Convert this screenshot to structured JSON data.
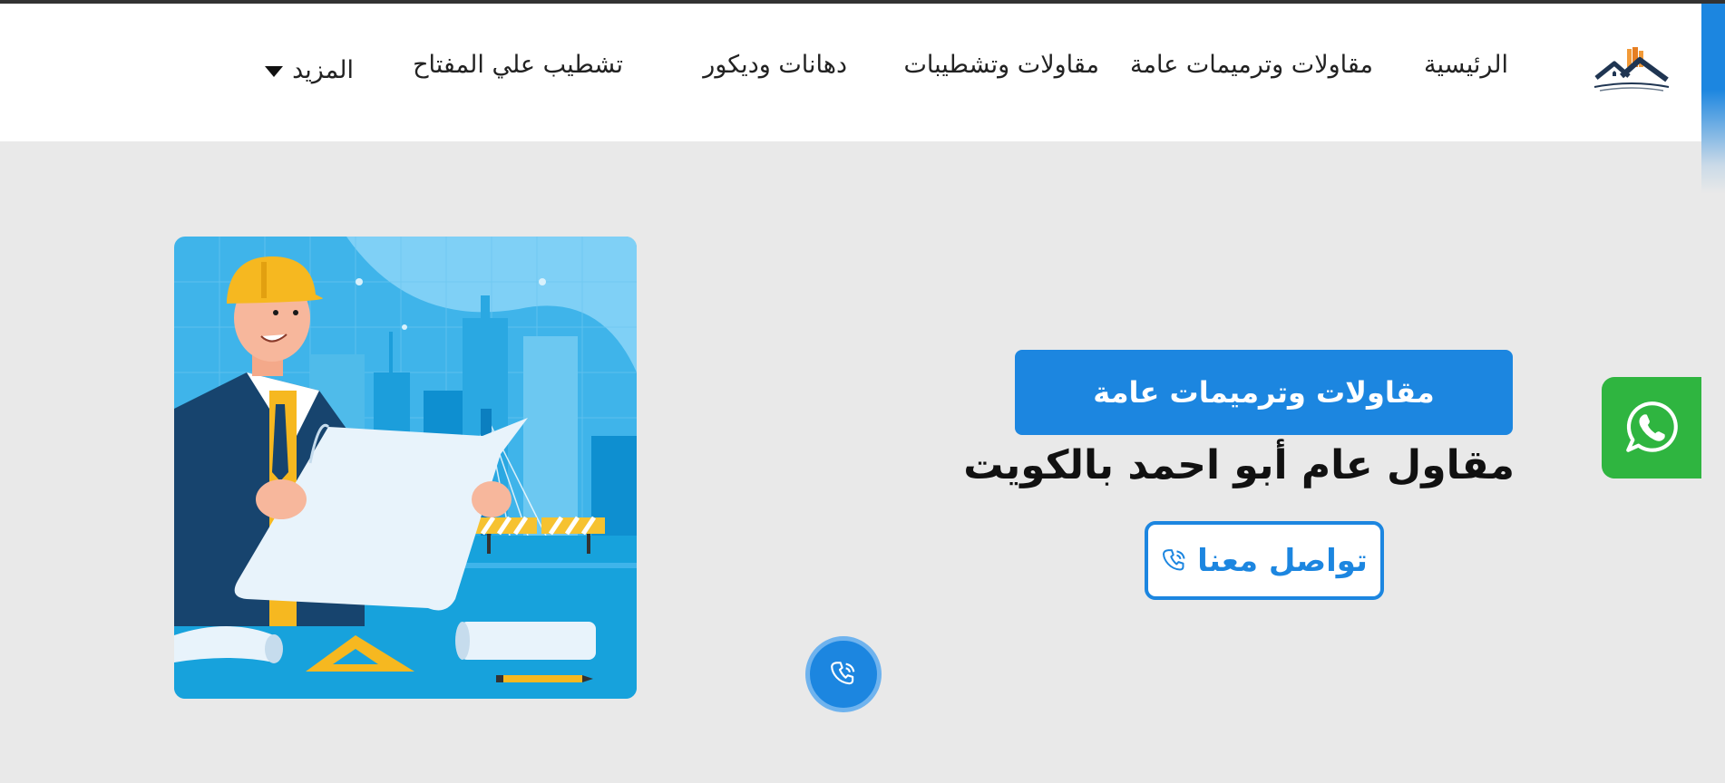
{
  "header": {
    "logo_icon": "house-roof-logo-icon",
    "nav": [
      {
        "label": "الرئيسية"
      },
      {
        "label": "مقاولات وترميمات عامة"
      },
      {
        "label": "مقاولات وتشطيبات"
      },
      {
        "label": "دهانات وديكور"
      },
      {
        "label": "تشطيب علي المفتاح"
      },
      {
        "label": "المزيد"
      }
    ]
  },
  "hero": {
    "image_icon": "engineer-illustration",
    "service_label": "مقاولات وترميمات عامة",
    "headline": "مقاول عام أبو احمد بالكويت",
    "contact_label": "تواصل معنا",
    "contact_icon": "phone-icon"
  },
  "floating": {
    "whatsapp_icon": "whatsapp-icon",
    "call_icon": "phone-icon"
  },
  "colors": {
    "accent": "#1c86e0",
    "whatsapp": "#2fb540",
    "background": "#e9e9e9"
  }
}
